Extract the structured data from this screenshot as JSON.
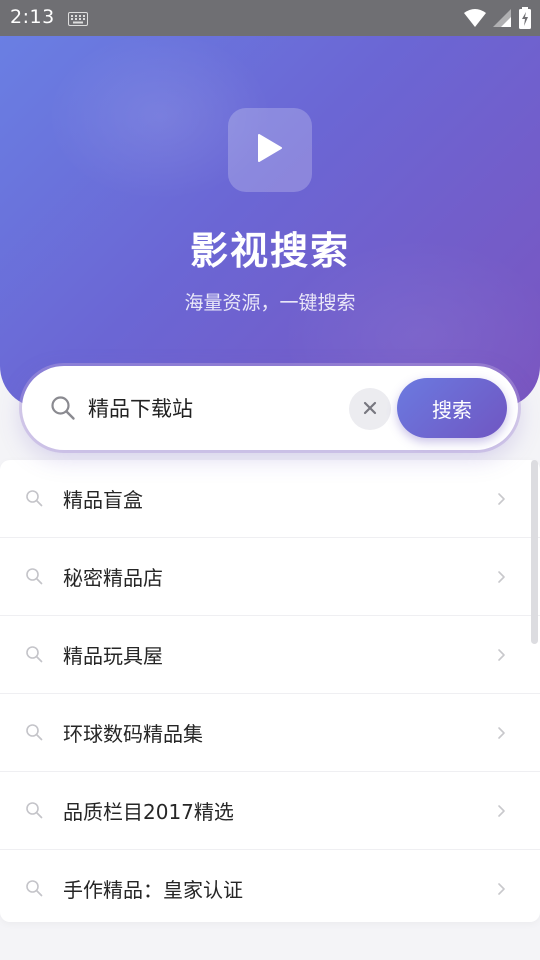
{
  "status_bar": {
    "time": "2:13",
    "icons": [
      "keyboard-icon",
      "wifi-icon",
      "signal-icon",
      "battery-icon"
    ]
  },
  "hero": {
    "icon": "play-icon",
    "title": "影视搜索",
    "subtitle": "海量资源，一键搜索"
  },
  "search": {
    "query": "精品下载站",
    "button_label": "搜索",
    "clear_icon": "close-icon"
  },
  "suggestions": [
    {
      "label": "精品盲盒"
    },
    {
      "label": "秘密精品店"
    },
    {
      "label": "精品玩具屋"
    },
    {
      "label": "环球数码精品集"
    },
    {
      "label": "品质栏目2017精选"
    },
    {
      "label": "手作精品：皇家认证"
    }
  ],
  "colors": {
    "gradient_start": "#6a7fe3",
    "gradient_end": "#7a55c0",
    "accent": "#6f5dcc",
    "status_bar": "#6f6f73"
  }
}
